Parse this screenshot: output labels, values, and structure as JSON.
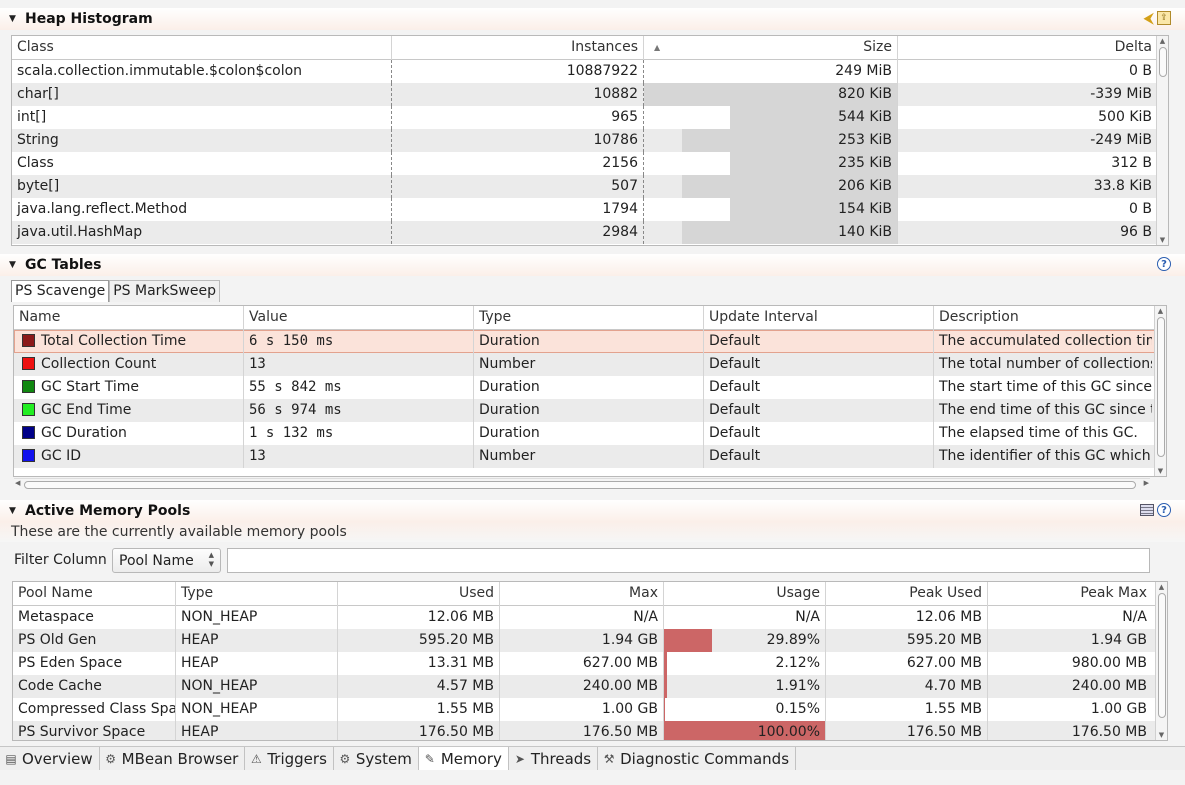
{
  "heap": {
    "title": "Heap Histogram",
    "columns": [
      "Class",
      "Instances",
      "Size",
      "Delta"
    ],
    "rows": [
      {
        "class": "scala.collection.immutable.$colon$colon",
        "instances": "10887922",
        "size": "249 MiB",
        "delta": "0 B",
        "size_fraction": 0.0
      },
      {
        "class": "char[]",
        "instances": "10882",
        "size": "820 KiB",
        "delta": "-339 MiB",
        "size_fraction": 1.0
      },
      {
        "class": "int[]",
        "instances": "965",
        "size": "544 KiB",
        "delta": "500 KiB",
        "size_fraction": 0.66
      },
      {
        "class": "String",
        "instances": "10786",
        "size": "253 KiB",
        "delta": "-249 MiB",
        "size_fraction": 0.85
      },
      {
        "class": "Class",
        "instances": "2156",
        "size": "235 KiB",
        "delta": "312 B",
        "size_fraction": 0.66
      },
      {
        "class": "byte[]",
        "instances": "507",
        "size": "206 KiB",
        "delta": "33.8 KiB",
        "size_fraction": 0.85
      },
      {
        "class": "java.lang.reflect.Method",
        "instances": "1794",
        "size": "154 KiB",
        "delta": "0 B",
        "size_fraction": 0.66
      },
      {
        "class": "java.util.HashMap",
        "instances": "2984",
        "size": "140 KiB",
        "delta": "96 B",
        "size_fraction": 0.85
      }
    ]
  },
  "gc": {
    "title": "GC Tables",
    "tabs": [
      "PS Scavenge",
      "PS MarkSweep"
    ],
    "columns": [
      "Name",
      "Value",
      "Type",
      "Update Interval",
      "Description"
    ],
    "rows": [
      {
        "name": "Total Collection Time",
        "color": "#8b1a1a",
        "value": "6 s 150 ms",
        "type": "Duration",
        "interval": "Default",
        "description": "The accumulated collection time"
      },
      {
        "name": "Collection Count",
        "color": "#ee1111",
        "value": "13",
        "type": "Number",
        "interval": "Default",
        "description": "The total number of collections"
      },
      {
        "name": "GC Start Time",
        "color": "#118811",
        "value": "55 s 842 ms",
        "type": "Duration",
        "interval": "Default",
        "description": "The start time of this GC since the"
      },
      {
        "name": "GC End Time",
        "color": "#22ee22",
        "value": "56 s 974 ms",
        "type": "Duration",
        "interval": "Default",
        "description": "The end time of this GC since the"
      },
      {
        "name": "GC Duration",
        "color": "#000088",
        "value": "1 s 132 ms",
        "type": "Duration",
        "interval": "Default",
        "description": "The elapsed time of this GC."
      },
      {
        "name": "GC ID",
        "color": "#1111ee",
        "value": "13",
        "type": "Number",
        "interval": "Default",
        "description": "The identifier of this GC which is"
      }
    ]
  },
  "pools": {
    "title": "Active Memory Pools",
    "subtitle": "These are the currently available memory pools",
    "filter_label": "Filter Column",
    "filter_select": "Pool Name",
    "filter_value": "",
    "columns": [
      "Pool Name",
      "Type",
      "Used",
      "Max",
      "Usage",
      "Peak Used",
      "Peak Max"
    ],
    "rows": [
      {
        "name": "Metaspace",
        "type": "NON_HEAP",
        "used": "12.06 MB",
        "max": "N/A",
        "usage": "N/A",
        "usage_pct": 0,
        "peak_used": "12.06 MB",
        "peak_max": "N/A"
      },
      {
        "name": "PS Old Gen",
        "type": "HEAP",
        "used": "595.20 MB",
        "max": "1.94 GB",
        "usage": "29.89%",
        "usage_pct": 29.89,
        "peak_used": "595.20 MB",
        "peak_max": "1.94 GB"
      },
      {
        "name": "PS Eden Space",
        "type": "HEAP",
        "used": "13.31 MB",
        "max": "627.00 MB",
        "usage": "2.12%",
        "usage_pct": 2.12,
        "peak_used": "627.00 MB",
        "peak_max": "980.00 MB"
      },
      {
        "name": "Code Cache",
        "type": "NON_HEAP",
        "used": "4.57 MB",
        "max": "240.00 MB",
        "usage": "1.91%",
        "usage_pct": 1.91,
        "peak_used": "4.70 MB",
        "peak_max": "240.00 MB"
      },
      {
        "name": "Compressed Class Space",
        "type": "NON_HEAP",
        "used": "1.55 MB",
        "max": "1.00 GB",
        "usage": "0.15%",
        "usage_pct": 0.15,
        "peak_used": "1.55 MB",
        "peak_max": "1.00 GB"
      },
      {
        "name": "PS Survivor Space",
        "type": "HEAP",
        "used": "176.50 MB",
        "max": "176.50 MB",
        "usage": "100.00%",
        "usage_pct": 100,
        "peak_used": "176.50 MB",
        "peak_max": "176.50 MB"
      }
    ]
  },
  "bottom_tabs": [
    {
      "label": "Overview",
      "icon": "overview-icon",
      "active": false
    },
    {
      "label": "MBean Browser",
      "icon": "mbean-icon",
      "active": false
    },
    {
      "label": "Triggers",
      "icon": "trigger-icon",
      "active": false
    },
    {
      "label": "System",
      "icon": "system-icon",
      "active": false
    },
    {
      "label": "Memory",
      "icon": "memory-icon",
      "active": true
    },
    {
      "label": "Threads",
      "icon": "threads-icon",
      "active": false
    },
    {
      "label": "Diagnostic Commands",
      "icon": "diagnostic-icon",
      "active": false
    }
  ]
}
